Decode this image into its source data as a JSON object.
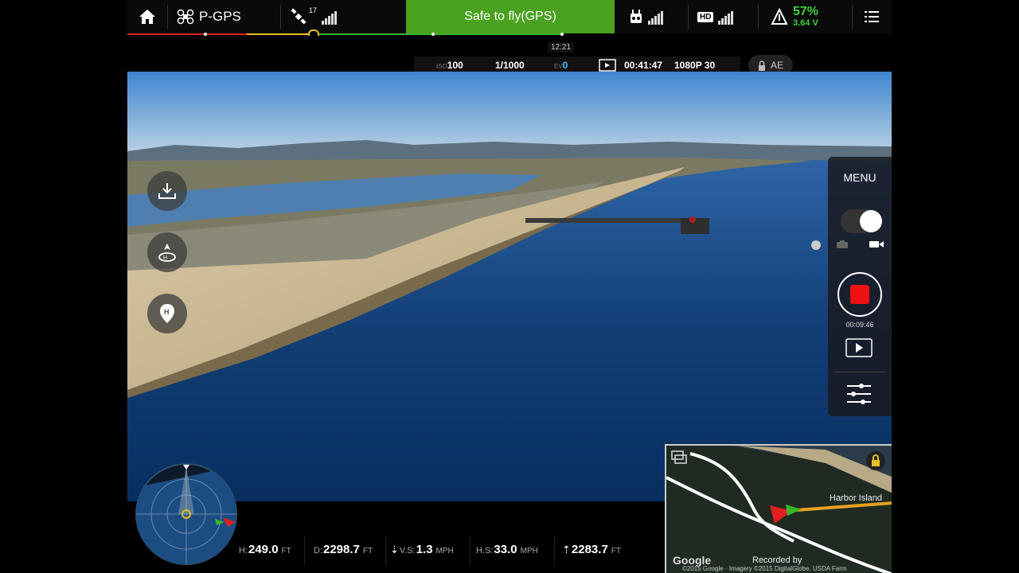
{
  "topbar": {
    "flight_mode": "P-GPS",
    "gps_sat_count": "17",
    "status": "Safe to fly(GPS)",
    "battery_percent": "57%",
    "battery_voltage": "3.64 V",
    "hd_label": "HD"
  },
  "progress": {
    "time_marker": "12:21",
    "colors": {
      "red": "#e02020",
      "yellow": "#e8c020",
      "green": "#3ab52a"
    }
  },
  "camera": {
    "iso_label": "ISO",
    "iso_value": "100",
    "shutter": "1/1000",
    "ev_label": "EV",
    "ev_value": "0",
    "record_time": "00:41:47",
    "resolution": "1080P 30",
    "ae_label": "AE"
  },
  "left_buttons": [
    {
      "icon": "download-icon"
    },
    {
      "icon": "return-home-icon"
    },
    {
      "icon": "map-pin-icon"
    }
  ],
  "right_panel": {
    "menu_label": "MENU",
    "recording_elapsed": "00:09:46",
    "photo_icon": "camera-icon",
    "video_icon": "video-icon"
  },
  "telemetry": {
    "h_label": "H:",
    "h_value": "249.0",
    "h_unit": "FT",
    "d_label": "D:",
    "d_value": "2298.7",
    "d_unit": "FT",
    "vs_label": "V.S:",
    "vs_value": "1.3",
    "vs_unit": "MPH",
    "hs_label": "H.S:",
    "hs_value": "33.0",
    "hs_unit": "MPH",
    "alt_value": "2283.7",
    "alt_unit": "FT"
  },
  "minimap": {
    "place_label": "Harbor Island",
    "google_label": "Google",
    "recorded_by": "Recorded by",
    "credit": "©2015 Google · Imagery ©2015 DigitalGlobe, USDA Farm"
  },
  "colors": {
    "safe_green": "#4aa11f",
    "battery_green": "#3ad13a",
    "record_red": "#ee1111"
  }
}
